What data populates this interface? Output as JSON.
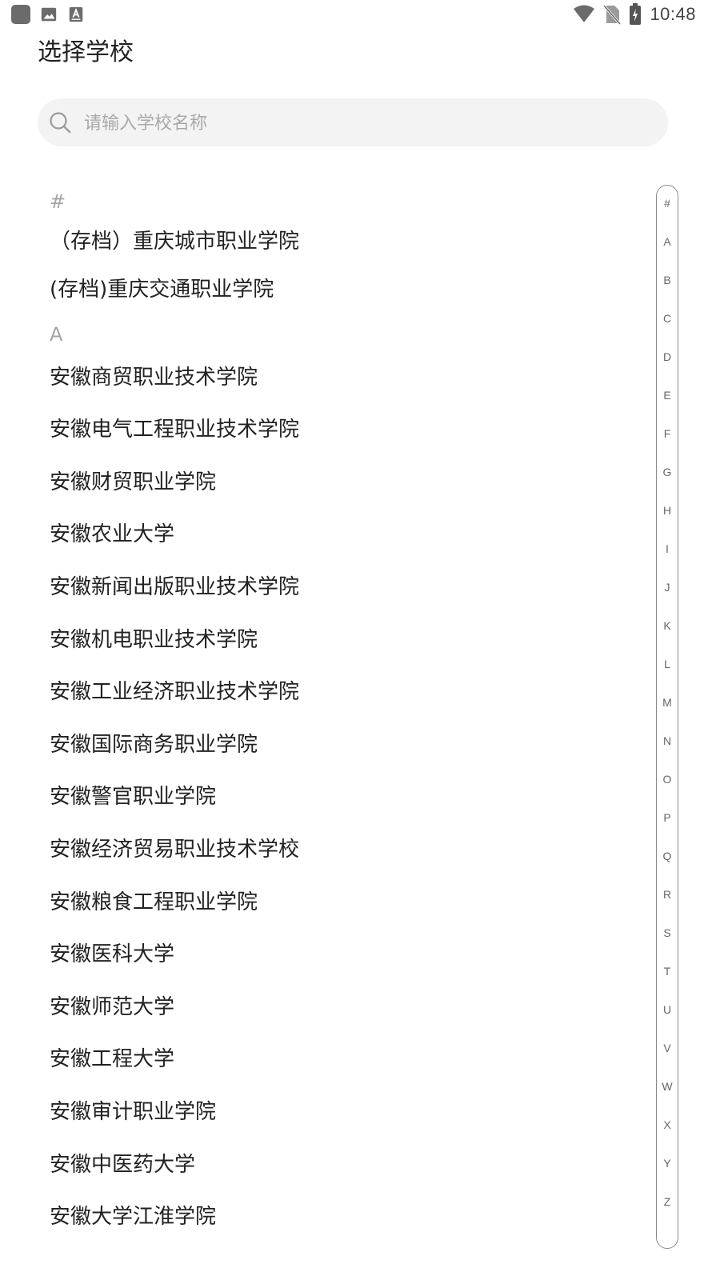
{
  "status_bar": {
    "time": "10:48"
  },
  "header": {
    "title": "选择学校"
  },
  "search": {
    "placeholder": "请输入学校名称"
  },
  "sections": [
    {
      "letter": "#",
      "items": [
        "（存档）重庆城市职业学院",
        "(存档)重庆交通职业学院"
      ]
    },
    {
      "letter": "A",
      "items": [
        "安徽商贸职业技术学院",
        "安徽电气工程职业技术学院",
        "安徽财贸职业学院",
        "安徽农业大学",
        "安徽新闻出版职业技术学院",
        "安徽机电职业技术学院",
        "安徽工业经济职业技术学院",
        "安徽国际商务职业学院",
        "安徽警官职业学院",
        "安徽经济贸易职业技术学校",
        "安徽粮食工程职业学院",
        "安徽医科大学",
        "安徽师范大学",
        "安徽工程大学",
        "安徽审计职业学院",
        "安徽中医药大学",
        "安徽大学江淮学院"
      ]
    }
  ],
  "index_letters": [
    "#",
    "A",
    "B",
    "C",
    "D",
    "E",
    "F",
    "G",
    "H",
    "I",
    "J",
    "K",
    "L",
    "M",
    "N",
    "O",
    "P",
    "Q",
    "R",
    "S",
    "T",
    "U",
    "V",
    "W",
    "X",
    "Y",
    "Z"
  ],
  "icons": {
    "status_left": [
      "app-icon",
      "image-icon",
      "a-badge-icon"
    ],
    "status_right": [
      "wifi-icon",
      "no-sim-icon",
      "battery-charging-icon"
    ],
    "search": "search-icon"
  }
}
